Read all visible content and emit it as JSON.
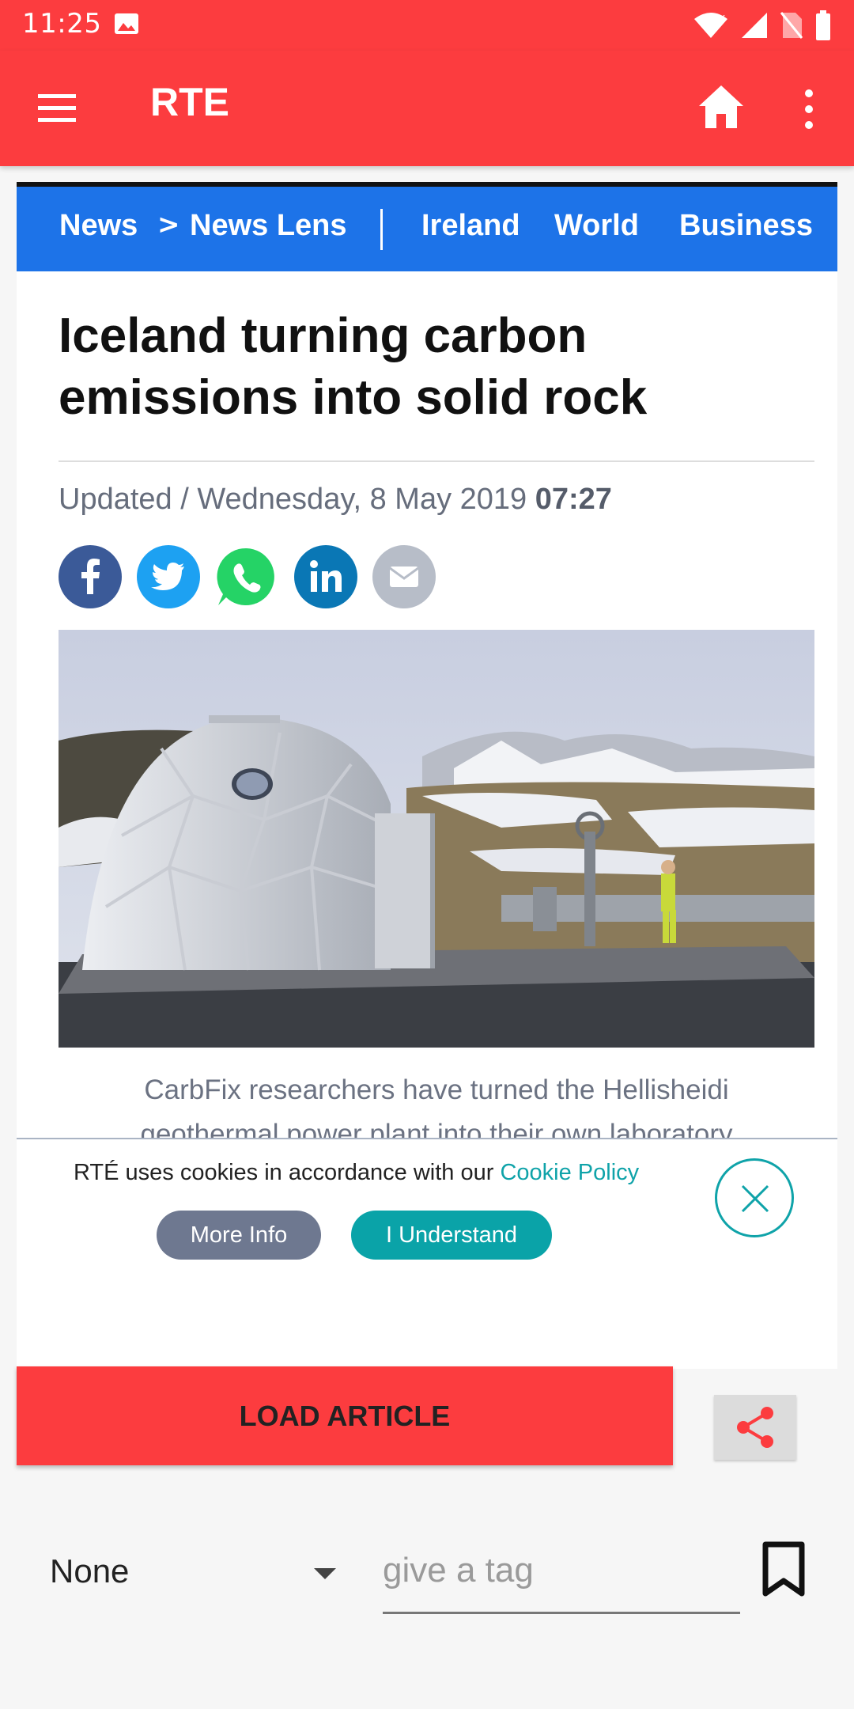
{
  "status_bar": {
    "time": "11:25",
    "icons": [
      "image-icon",
      "wifi-icon",
      "signal-icon",
      "no-sim-icon",
      "battery-icon"
    ]
  },
  "app_bar": {
    "title": "RTE",
    "icons": [
      "menu-icon",
      "home-icon",
      "more-vert-icon"
    ],
    "color": "#fc3c3f"
  },
  "nav": {
    "items": [
      "News",
      "News Lens",
      "Ireland",
      "World",
      "Business"
    ],
    "separator": ">",
    "color": "#1d73e8"
  },
  "article": {
    "headline_line1": "Iceland turning carbon",
    "headline_line2": "emissions into solid rock",
    "updated_label": "Updated / Wednesday, 8 May 2019 ",
    "updated_time": "07:27",
    "share_icons": [
      "facebook-icon",
      "twitter-icon",
      "whatsapp-icon",
      "linkedin-icon",
      "email-icon"
    ],
    "caption_line1": "CarbFix researchers have turned the Hellisheidi",
    "caption_line2": "geothermal power plant into their own laboratory"
  },
  "cookie_banner": {
    "text": "RTÉ uses cookies in accordance with our ",
    "link": "Cookie Policy",
    "more_info": "More Info",
    "understand": "I Understand"
  },
  "actions": {
    "load_article": "LOAD ARTICLE",
    "dropdown_value": "None",
    "tag_placeholder": "give a tag"
  }
}
